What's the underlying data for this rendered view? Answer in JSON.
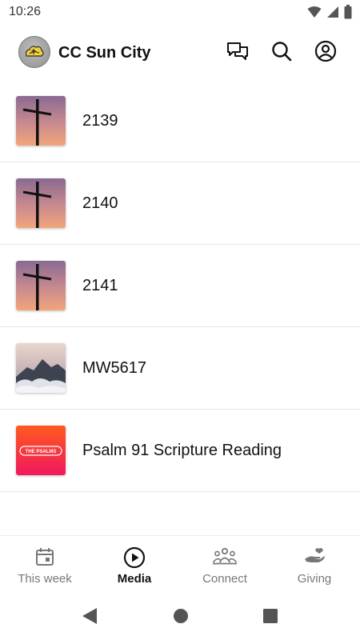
{
  "status_bar": {
    "time": "10:26",
    "icons": [
      "wifi-icon",
      "cellular-signal-icon",
      "battery-icon"
    ]
  },
  "header": {
    "logo_icon": "church-logo",
    "title": "CC Sun City",
    "actions": [
      "chat-icon",
      "search-icon",
      "profile-icon"
    ]
  },
  "media_items": [
    {
      "title": "2139",
      "thumbnail": "cross-sunset"
    },
    {
      "title": "2140",
      "thumbnail": "cross-sunset"
    },
    {
      "title": "2141",
      "thumbnail": "cross-sunset"
    },
    {
      "title": "MW5617",
      "thumbnail": "mountain-clouds"
    },
    {
      "title": "Psalm 91 Scripture Reading",
      "thumbnail": "the-psalms",
      "thumbnail_text": "THE PSALMS"
    }
  ],
  "bottom_nav": {
    "tabs": [
      {
        "label": "This week",
        "icon": "calendar-icon",
        "active": false
      },
      {
        "label": "Media",
        "icon": "play-circle-icon",
        "active": true
      },
      {
        "label": "Connect",
        "icon": "group-icon",
        "active": false
      },
      {
        "label": "Giving",
        "icon": "giving-hand-icon",
        "active": false
      }
    ]
  },
  "system_nav": [
    "back-icon",
    "home-icon",
    "recents-icon"
  ],
  "colors": {
    "text_primary": "#111111",
    "text_inactive": "#777777",
    "divider": "#e6e6e6"
  }
}
